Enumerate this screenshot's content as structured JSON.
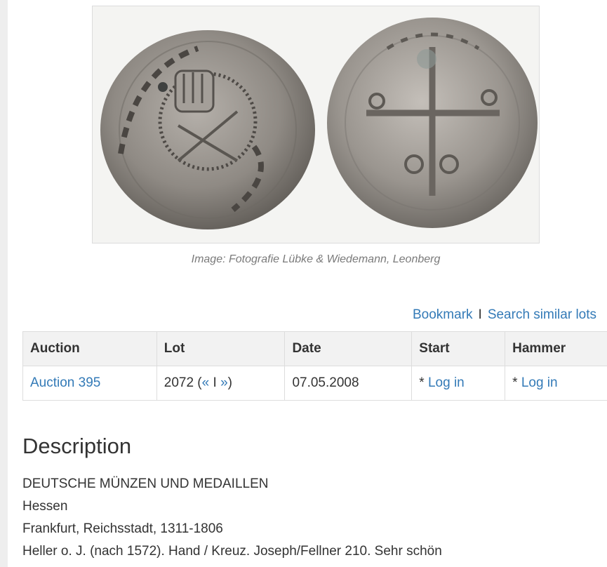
{
  "image": {
    "alt": "Silver coin, obverse and reverse",
    "caption": "Image: Fotografie Lübke & Wiedemann, Leonberg"
  },
  "actions": {
    "bookmark": "Bookmark",
    "separator": "I",
    "search_similar": "Search similar lots"
  },
  "table": {
    "headers": {
      "auction": "Auction",
      "lot": "Lot",
      "date": "Date",
      "start": "Start",
      "hammer": "Hammer"
    },
    "row": {
      "auction": "Auction 395",
      "lot_number": "2072",
      "lot_open": " (",
      "prev": "«",
      "lot_sep": " I ",
      "next": "»",
      "lot_close": ")",
      "date": "07.05.2008",
      "start_prefix": "* ",
      "start_link": "Log in",
      "hammer_prefix": "* ",
      "hammer_link": "Log in"
    }
  },
  "description": {
    "heading": "Description",
    "lines": [
      "DEUTSCHE MÜNZEN UND MEDAILLEN",
      "Hessen",
      "Frankfurt, Reichsstadt, 1311-1806",
      "Heller o. J. (nach 1572). Hand / Kreuz. Joseph/Fellner 210. Sehr schön"
    ]
  },
  "colors": {
    "link": "#337ab7",
    "coin": "#8a8580",
    "header_bg": "#f2f2f2"
  }
}
